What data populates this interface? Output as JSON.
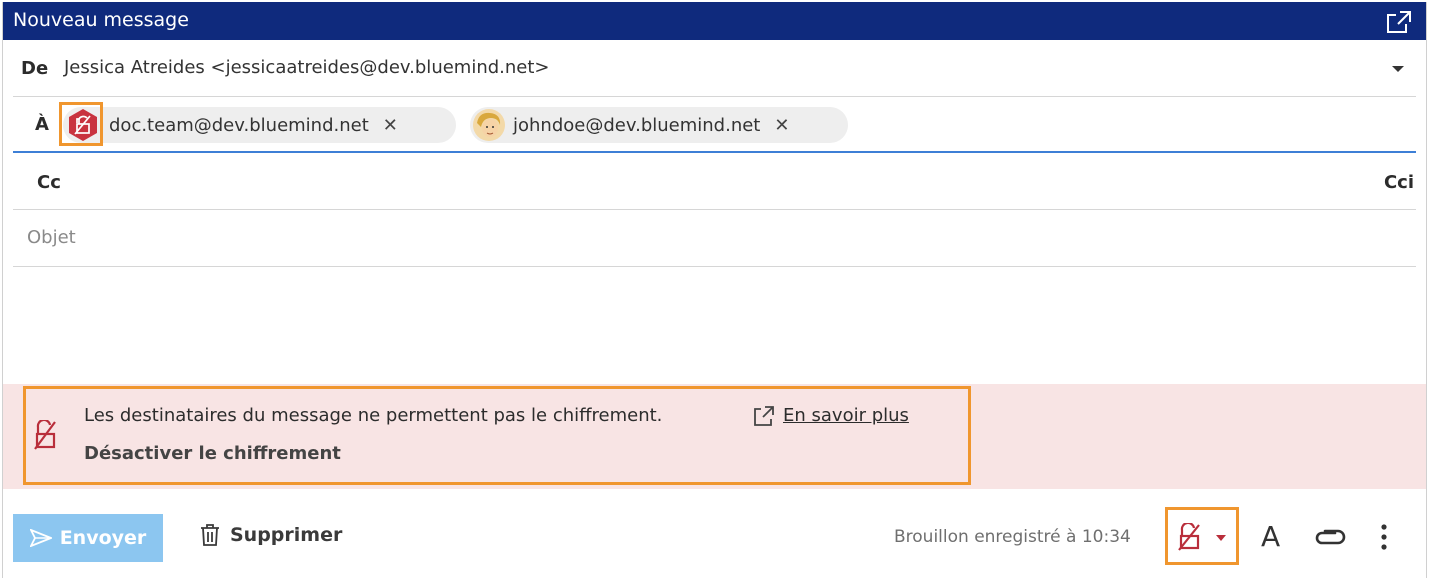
{
  "window": {
    "title": "Nouveau message"
  },
  "from": {
    "label": "De",
    "value": "Jessica Atreides <jessicaatreides@dev.bluemind.net>"
  },
  "to": {
    "label": "À",
    "recipients": [
      {
        "email": "doc.team@dev.bluemind.net",
        "icon": "no-encryption-hexagon-icon"
      },
      {
        "email": "johndoe@dev.bluemind.net",
        "icon": "avatar"
      }
    ],
    "remove_glyph": "✕"
  },
  "cc": {
    "label": "Cc",
    "bcc_label": "Cci"
  },
  "subject": {
    "placeholder": "Objet"
  },
  "alert": {
    "message": "Les destinataires du message ne permettent pas le chiffrement.",
    "link": "En savoir plus",
    "action": "Désactiver le chiffrement"
  },
  "footer": {
    "send_label": "Envoyer",
    "delete_label": "Supprimer",
    "draft_status": "Brouillon enregistré à 10:34",
    "format_glyph": "A"
  },
  "colors": {
    "titlebar": "#0f2a7d",
    "accent_highlight": "#f0962e",
    "alert_bg": "#f8e4e4",
    "danger": "#b92e3b",
    "send_button": "#8cc6f0",
    "focus_underline": "#3d7fd6"
  }
}
